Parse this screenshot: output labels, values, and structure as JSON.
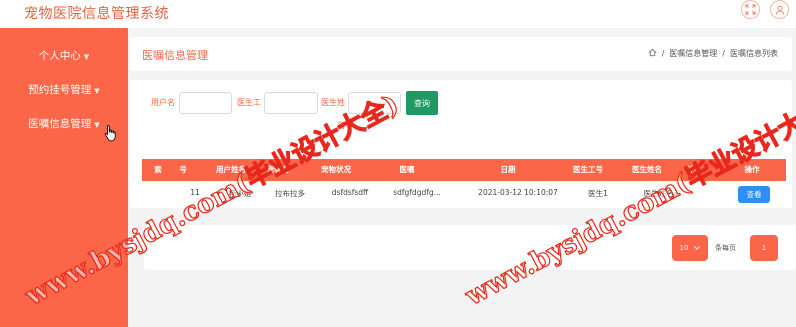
{
  "app": {
    "title": "宠物医院信息管理系统"
  },
  "top_icons": [
    "fullscreen-icon",
    "user-icon"
  ],
  "sidebar": {
    "items": [
      {
        "label": "个人中心"
      },
      {
        "label": "预约挂号管理"
      },
      {
        "label": "医嘱信息管理"
      }
    ]
  },
  "header": {
    "title": "医嘱信息管理",
    "breadcrumb": [
      "医嘱信息管理",
      "医嘱信息列表"
    ],
    "separator": "/"
  },
  "search": {
    "username_label": "用户名",
    "doctor_no_label": "医生工",
    "doctor_name_label_1": "医生姓",
    "doctor_name_label_2": "名",
    "username_value": "",
    "doctor_no_value": "",
    "doctor_name_value": "",
    "button_label": "查询"
  },
  "table": {
    "columns": [
      "索",
      "号",
      "用户姓名",
      "宠物名",
      "宠物状况",
      "医嘱",
      "日期",
      "医生工号",
      "医生姓名",
      "科室",
      "操作"
    ],
    "rows": [
      {
        "index": "11",
        "user_name": "杨小姐",
        "pet_name": "拉布拉多",
        "pet_condition": "dsfdsfsdff",
        "advice": "sdfgfdgdfg...",
        "date": "2021-03-12 10:10:07",
        "doctor_no": "医生1",
        "doctor_name": "医生姓名1",
        "action_label": "查看"
      }
    ]
  },
  "pagination": {
    "page_size": "10",
    "per_page_label": "条每页",
    "current_page": "1"
  },
  "watermark": {
    "text": "www.bysjdq.com(毕业设计大全)"
  },
  "colors": {
    "accent": "#fb6649",
    "search_button": "#1e9a62",
    "view_button": "#2d8ef6",
    "watermark": "#e8281c"
  }
}
